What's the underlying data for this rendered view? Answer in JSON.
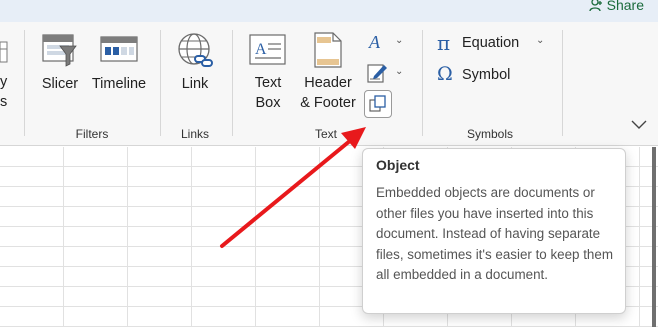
{
  "titlebar": {
    "share_label": "Share"
  },
  "ribbon": {
    "left_partial_label_1": "y",
    "left_partial_label_2": "s",
    "filters": {
      "slicer_label": "Slicer",
      "timeline_label": "Timeline",
      "group_label": "Filters"
    },
    "links": {
      "link_label": "Link",
      "group_label": "Links"
    },
    "text": {
      "textbox_line1": "Text",
      "textbox_line2": "Box",
      "header_line1": "Header",
      "header_line2": "& Footer",
      "group_label": "Text"
    },
    "symbols": {
      "equation_label": "Equation",
      "symbol_label": "Symbol",
      "group_label": "Symbols"
    }
  },
  "tooltip": {
    "title": "Object",
    "body": "Embedded objects are documents or other files you have inserted into this document. Instead of having separate files, sometimes it's easier to keep them all embedded in a document."
  },
  "colors": {
    "arrow": "#e8191c",
    "share_green": "#1b6b3c",
    "ribbon_bg": "#f7f7f7",
    "accent_blue": "#2b5fa5"
  }
}
